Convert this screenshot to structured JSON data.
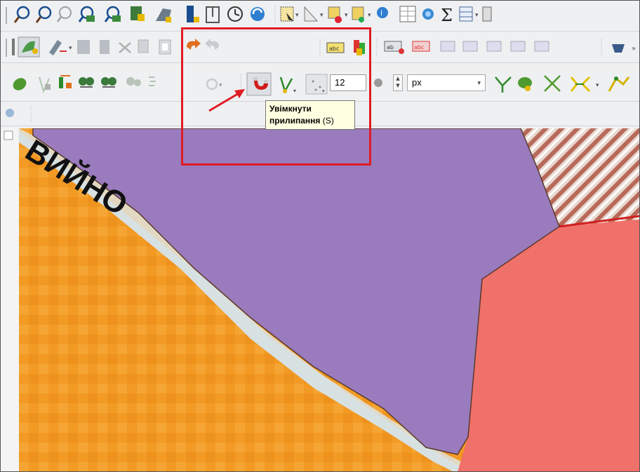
{
  "tooltip": {
    "title": "Увімкнути прилипання",
    "title_line1": "Увімкнути",
    "title_line2": "прилипання",
    "shortcut": "(S)"
  },
  "snapping": {
    "tolerance_value": "12",
    "units_value": "px"
  },
  "map_labels": {
    "road_name_fragment": "ВИЙНО"
  },
  "colors": {
    "highlight": "#e01b24",
    "polygon_fill": "#9a7bbd",
    "orthophoto_orange": "#f29a24",
    "salmon_area": "#f0706a",
    "tooltip_bg": "#ffffe1"
  },
  "icons": {
    "row1": [
      "pan-map-icon",
      "pan-to-selection-icon",
      "zoom-in-icon",
      "zoom-out-icon",
      "zoom-full-icon",
      "zoom-layer-icon",
      "zoom-native-icon",
      "zoom-last-icon",
      "zoom-next-icon",
      "temporal-clock-icon",
      "refresh-icon",
      "select-features-icon",
      "select-by-value-icon",
      "deselect-icon",
      "select-location-icon",
      "identify-icon",
      "attribute-table-icon",
      "statistics-icon",
      "sum-icon",
      "open-table-icon"
    ],
    "row2": [
      "current-edits-icon",
      "toggle-editing-icon",
      "save-edits-icon",
      "add-feature-icon",
      "delete-icon",
      "cut-icon",
      "copy-icon",
      "paste-icon",
      "undo-icon",
      "redo-icon",
      "label-icon",
      "layer-label-icon",
      "pin-label-icon",
      "show-hide-label-icon",
      "move-label-icon",
      "rotate-label-icon",
      "change-label-icon",
      "digitize-icon"
    ],
    "row3": [
      "polygon-add-ring-icon",
      "vertex-tool-icon",
      "split-features-icon",
      "merge-features-icon",
      "merge-attributes-icon",
      "reshape-icon",
      "offset-curve-icon",
      "rotate-feature-icon",
      "enable-snapping-icon",
      "snapping-layers-icon",
      "snapping-type-icon",
      "clear-input-icon",
      "spinbox-icon",
      "trace-icon",
      "fill-ring-icon",
      "delete-ring-icon",
      "split-parts-icon",
      "simplify-icon"
    ]
  }
}
